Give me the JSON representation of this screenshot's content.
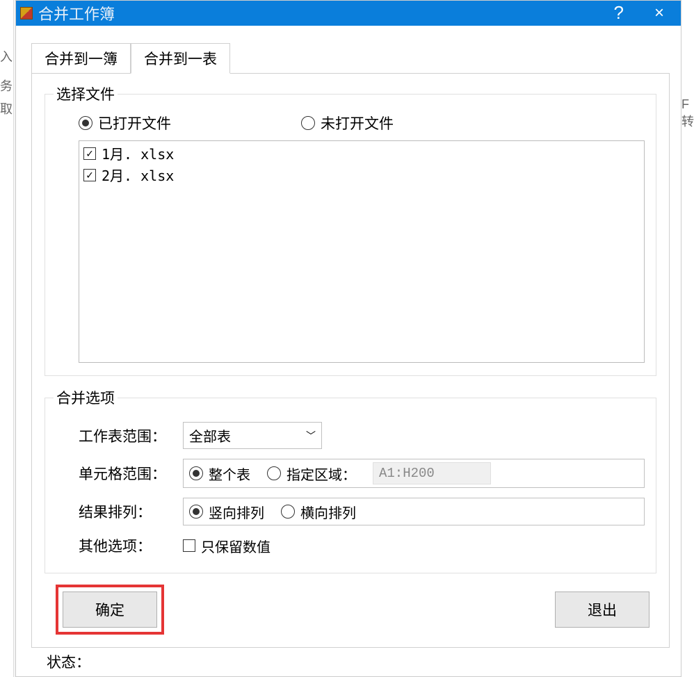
{
  "titlebar": {
    "title": "合并工作簿",
    "help": "?",
    "close": "×"
  },
  "tabs": {
    "tab1": "合并到一簿",
    "tab2": "合并到一表"
  },
  "file_section": {
    "legend": "选择文件",
    "opened_label": "已打开文件",
    "unopened_label": "未打开文件",
    "files": [
      "1月. xlsx",
      "2月. xlsx"
    ]
  },
  "merge_options": {
    "legend": "合并选项",
    "sheet_range_label": "工作表范围：",
    "sheet_range_value": "全部表",
    "cell_range_label": "单元格范围：",
    "whole_sheet": "整个表",
    "specified_range": "指定区域：",
    "specified_range_value": "A1:H200",
    "result_layout_label": "结果排列：",
    "vertical": "竖向排列",
    "horizontal": "横向排列",
    "other_options_label": "其他选项：",
    "keep_values_only": "只保留数值"
  },
  "buttons": {
    "confirm": "确定",
    "exit": "退出"
  },
  "status": {
    "label": "状态："
  },
  "bg_chars": {
    "c1": "入",
    "c2": "务",
    "c3": "取",
    "c4": "F转"
  }
}
